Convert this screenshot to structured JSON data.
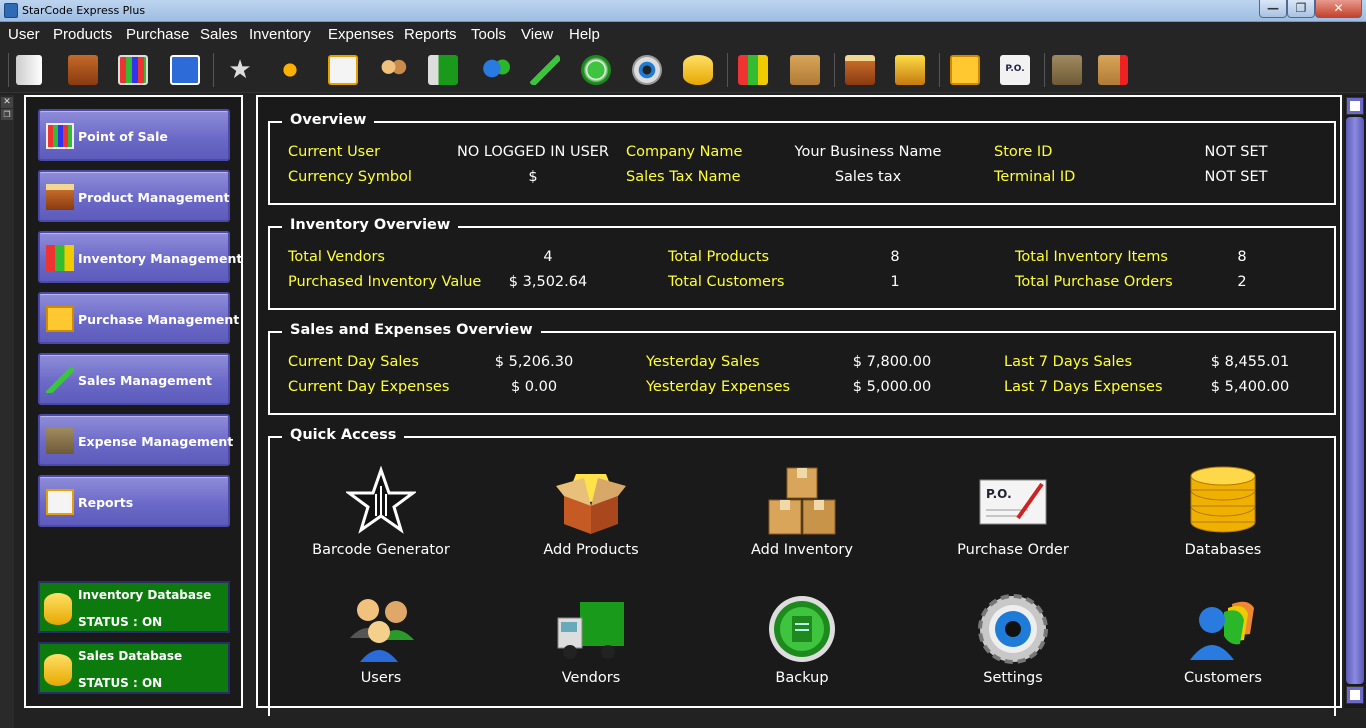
{
  "window": {
    "title": "StarCode Express Plus",
    "minimize": "—",
    "maximize": "❐",
    "close": "✕"
  },
  "menu": [
    "User",
    "Products",
    "Purchase",
    "Sales",
    "Inventory",
    "Expenses",
    "Reports",
    "Tools",
    "View",
    "Help"
  ],
  "toolbar_icons": [
    "logout-icon",
    "exit-door-icon",
    "pos-register-icon",
    "home-icon",
    "barcode-star-icon",
    "org-chart-icon",
    "reports-icon",
    "users-icon",
    "vendors-truck-icon",
    "customers-icon",
    "sales-chart-icon",
    "backup-icon",
    "settings-icon",
    "database-icon",
    "inventory-cubes-icon",
    "add-inventory-boxes-icon",
    "add-products-icon",
    "product-box-icon",
    "purchase-notes-icon",
    "purchase-order-icon",
    "expense-wallet-icon",
    "add-expense-icon"
  ],
  "sidebar": {
    "buttons": [
      {
        "label": "Point of Sale",
        "icon": "pos-register-icon"
      },
      {
        "label": "Product Management",
        "icon": "product-box-icon"
      },
      {
        "label": "Inventory Management",
        "icon": "inventory-cubes-icon"
      },
      {
        "label": "Purchase Management",
        "icon": "purchase-notes-icon"
      },
      {
        "label": "Sales Management",
        "icon": "sales-chart-icon"
      },
      {
        "label": "Expense Management",
        "icon": "expense-wallet-icon"
      },
      {
        "label": "Reports",
        "icon": "reports-icon"
      }
    ],
    "databases": [
      {
        "name": "Inventory Database",
        "status": "STATUS : ON"
      },
      {
        "name": "Sales Database",
        "status": "STATUS : ON"
      }
    ]
  },
  "overview": {
    "title": "Overview",
    "current_user_label": "Current User",
    "current_user": "NO LOGGED IN USER",
    "company_name_label": "Company Name",
    "company_name": "Your Business Name",
    "store_id_label": "Store ID",
    "store_id": "NOT SET",
    "currency_symbol_label": "Currency Symbol",
    "currency_symbol": "$",
    "sales_tax_name_label": "Sales Tax Name",
    "sales_tax_name": "Sales tax",
    "terminal_id_label": "Terminal ID",
    "terminal_id": "NOT SET"
  },
  "inventory_overview": {
    "title": "Inventory Overview",
    "total_vendors_label": "Total Vendors",
    "total_vendors": "4",
    "total_products_label": "Total Products",
    "total_products": "8",
    "total_inventory_items_label": "Total Inventory Items",
    "total_inventory_items": "8",
    "purchased_value_label": "Purchased Inventory Value",
    "purchased_value": "$ 3,502.64",
    "total_customers_label": "Total Customers",
    "total_customers": "1",
    "total_purchase_orders_label": "Total Purchase Orders",
    "total_purchase_orders": "2"
  },
  "sales_expenses": {
    "title": "Sales and Expenses Overview",
    "current_day_sales_label": "Current Day Sales",
    "current_day_sales": "$ 5,206.30",
    "yesterday_sales_label": "Yesterday Sales",
    "yesterday_sales": "$ 7,800.00",
    "last7_sales_label": "Last 7 Days Sales",
    "last7_sales": "$ 8,455.01",
    "current_day_expenses_label": "Current Day Expenses",
    "current_day_expenses": "$ 0.00",
    "yesterday_expenses_label": "Yesterday Expenses",
    "yesterday_expenses": "$ 5,000.00",
    "last7_expenses_label": "Last 7 Days Expenses",
    "last7_expenses": "$ 5,400.00"
  },
  "quick_access": {
    "title": "Quick Access",
    "items": [
      {
        "label": "Barcode Generator",
        "icon": "barcode-star-icon"
      },
      {
        "label": "Add Products",
        "icon": "add-products-icon"
      },
      {
        "label": "Add Inventory",
        "icon": "add-inventory-boxes-icon"
      },
      {
        "label": "Purchase Order",
        "icon": "purchase-order-icon"
      },
      {
        "label": "Databases",
        "icon": "database-icon"
      },
      {
        "label": "Users",
        "icon": "users-icon"
      },
      {
        "label": "Vendors",
        "icon": "vendors-truck-icon"
      },
      {
        "label": "Backup",
        "icon": "backup-icon"
      },
      {
        "label": "Settings",
        "icon": "settings-icon"
      },
      {
        "label": "Customers",
        "icon": "customers-icon"
      }
    ],
    "po_text": "P.O."
  }
}
